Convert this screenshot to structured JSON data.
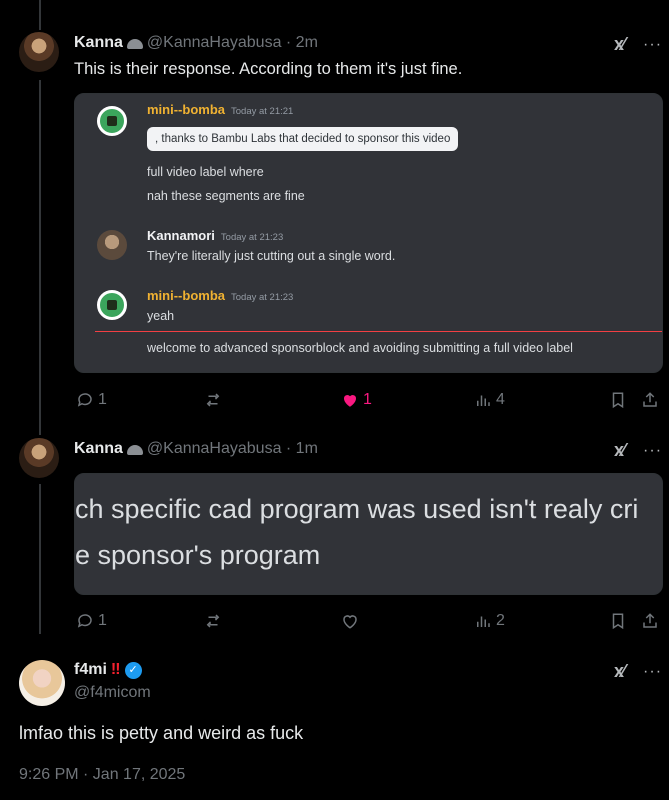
{
  "tweet1": {
    "name": "Kanna",
    "handle": "@KannaHayabusa · 2m",
    "text": "This is their response. According to them it's just fine.",
    "grok_label": "x⁄",
    "more_label": "···",
    "discord": {
      "msg1_name": "mini--bomba",
      "msg1_time": "Today at 21:21",
      "msg1_reply": ", thanks to Bambu Labs that decided to sponsor this video",
      "msg1_line1": "full video label where",
      "msg1_line2": "nah these segments are fine",
      "msg2_name": "Kannamori",
      "msg2_time": "Today at 21:23",
      "msg2_text": "They're literally just cutting out a single word.",
      "msg3_name": "mini--bomba",
      "msg3_time": "Today at 21:23",
      "msg3_text": "yeah",
      "msg3_line2": "welcome to advanced sponsorblock and avoiding submitting a full video label"
    },
    "replies": "1",
    "likes": "1",
    "views": "4"
  },
  "tweet2": {
    "name": "Kanna",
    "handle": "@KannaHayabusa · 1m",
    "grok_label": "x⁄",
    "more_label": "···",
    "image_line1": "ch specific cad program was used isn't realy cri",
    "image_line2": "e sponsor's program",
    "replies": "1",
    "views": "2"
  },
  "tweet3": {
    "name": "f4mi",
    "bangs": "‼",
    "handle": "@f4micom",
    "grok_label": "x⁄",
    "more_label": "···",
    "text": "lmfao this is petty and weird as fuck",
    "timestamp": "9:26 PM · Jan 17, 2025"
  },
  "colors": {
    "background": "#000000",
    "like_pink": "#f91880",
    "verified_blue": "#1d9bf0",
    "discord_bg": "#313338",
    "mini_bomba_name": "#f0b232",
    "kannamori_name": "#f2f3f5"
  }
}
